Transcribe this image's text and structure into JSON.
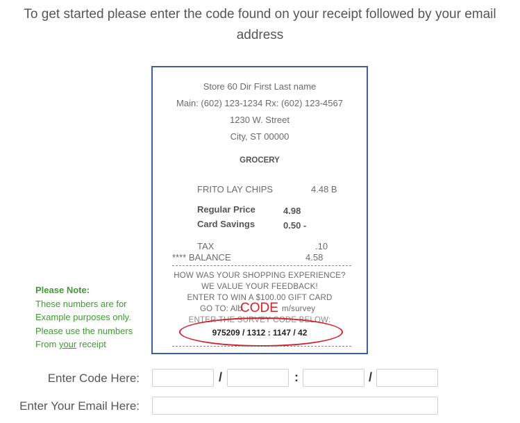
{
  "intro": {
    "line1": "To get started please enter the code found on your receipt followed by your email",
    "line2": "address"
  },
  "receipt": {
    "store": "Store 60 Dir First Last name",
    "phone": "Main: (602) 123-1234 Rx: (602) 123-4567",
    "street": "1230 W. Street",
    "city": "City, ST 00000",
    "department": "GROCERY",
    "item_name": "FRITO LAY CHIPS",
    "item_price": "4.48 B",
    "regular_label": "Regular  Price",
    "regular_value": "4.98",
    "savings_label": "Card Savings",
    "savings_value": "0.50 -",
    "tax_label": "TAX",
    "tax_value": ".10",
    "balance_label": "**** BALANCE",
    "balance_value": "4.58",
    "survey_1": "HOW WAS YOUR SHOPPING EXPERIENCE?",
    "survey_2": "WE VALUE YOUR FEEDBACK!",
    "survey_3": "ENTER TO WIN A $100.00 GIFT CARD",
    "survey_4": "GO TO: Alb",
    "survey_4b": "m/survey",
    "survey_5": "ENTER THE SURVEY CODE BELOW:",
    "code_label": "CODE",
    "code_value": "975209 / 1312 : 1147 / 42"
  },
  "note": {
    "title": "Please Note:",
    "line1": "These numbers are for",
    "line2": "Example purposes only.",
    "line3": "Please use the numbers",
    "line4_pre": "From ",
    "line4_link": "your",
    "line4_post": " receipt"
  },
  "form": {
    "code_label": "Enter Code Here:",
    "email_label": "Enter Your Email Here:",
    "sep1": "/",
    "sep2": ":",
    "sep3": "/",
    "code_part1": "",
    "code_part2": "",
    "code_part3": "",
    "code_part4": "",
    "email_value": ""
  },
  "colors": {
    "note_green": "#3f9a31",
    "code_red": "#d2232a",
    "receipt_border": "#3f5f95"
  }
}
